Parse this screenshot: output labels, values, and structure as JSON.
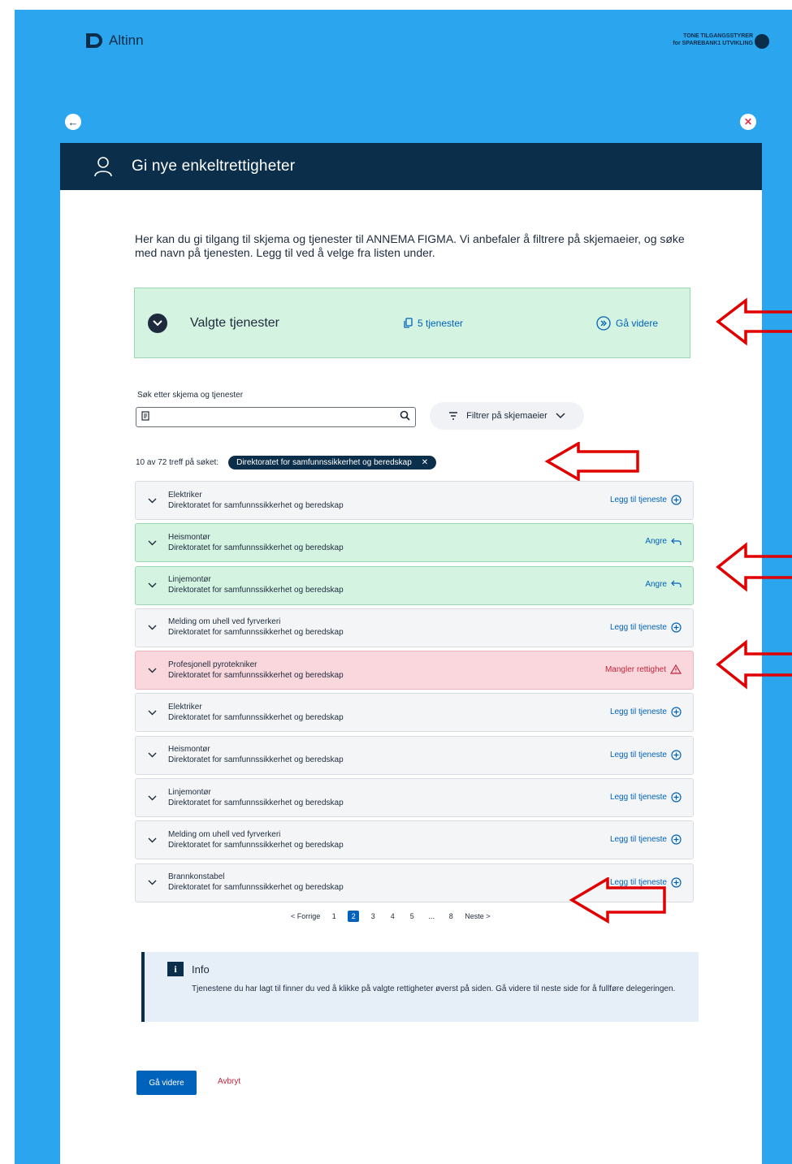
{
  "brand": {
    "name": "Altinn"
  },
  "user": {
    "name": "TONE TILGANGSSTYRER",
    "org": "for SPAREBANK1 UTVIKLING"
  },
  "header": {
    "title": "Gi nye enkeltrettigheter"
  },
  "intro": "Her kan du gi tilgang til skjema og tjenester til ANNEMA FIGMA. Vi anbefaler å filtrere på skjemaeier, og søke med navn på tjenesten. Legg til ved å velge fra listen under.",
  "selected": {
    "title": "Valgte tjenester",
    "count": "5 tjenester",
    "next": "Gå videre"
  },
  "search": {
    "label": "Søk etter skjema og tjenester",
    "value": "",
    "placeholder": ""
  },
  "filter": {
    "label": "Filtrer på skjemaeier"
  },
  "results": {
    "summary": "10 av 72 treff på søket:",
    "chip": "Direktoratet for samfunnssikkerhet og beredskap"
  },
  "services": [
    {
      "title": "Elektriker",
      "owner": "Direktoratet for samfunnssikkerhet og beredskap",
      "action": "Legg til tjeneste",
      "state": "default"
    },
    {
      "title": "Heismontør",
      "owner": "Direktoratet for samfunnssikkerhet og beredskap",
      "action": "Angre",
      "state": "added"
    },
    {
      "title": "Linjemontør",
      "owner": "Direktoratet for samfunnssikkerhet og beredskap",
      "action": "Angre",
      "state": "added"
    },
    {
      "title": "Melding om uhell ved fyrverkeri",
      "owner": "Direktoratet for samfunnssikkerhet og beredskap",
      "action": "Legg til tjeneste",
      "state": "default"
    },
    {
      "title": "Profesjonell pyrotekniker",
      "owner": "Direktoratet for samfunnssikkerhet og beredskap",
      "action": "Mangler rettighet",
      "state": "error"
    },
    {
      "title": "Elektriker",
      "owner": "Direktoratet for samfunnssikkerhet og beredskap",
      "action": "Legg til tjeneste",
      "state": "default"
    },
    {
      "title": "Heismontør",
      "owner": "Direktoratet for samfunnssikkerhet og beredskap",
      "action": "Legg til tjeneste",
      "state": "default"
    },
    {
      "title": "Linjemontør",
      "owner": "Direktoratet for samfunnssikkerhet og beredskap",
      "action": "Legg til tjeneste",
      "state": "default"
    },
    {
      "title": "Melding om uhell ved fyrverkeri",
      "owner": "Direktoratet for samfunnssikkerhet og beredskap",
      "action": "Legg til tjeneste",
      "state": "default"
    },
    {
      "title": "Brannkonstabel",
      "owner": "Direktoratet for samfunnssikkerhet og beredskap",
      "action": "Legg til tjeneste",
      "state": "default"
    }
  ],
  "pagination": {
    "prev": "< Forrige",
    "pages": [
      "1",
      "2",
      "3",
      "4",
      "5",
      "...",
      "8"
    ],
    "active": "2",
    "next": "Neste >"
  },
  "info": {
    "title": "Info",
    "body": "Tjenestene du har lagt til finner du ved å klikke på valgte rettigheter øverst på siden. Gå videre til neste side for å fullføre delegeringen."
  },
  "footer": {
    "next": "Gå videre",
    "cancel": "Avbryt"
  },
  "colors": {
    "background": "#2aa5ee",
    "header": "#0b2e4a",
    "accent": "#0062ba",
    "added": "#d4f3e1",
    "error": "#f9d7dc",
    "annotation": "#e00000"
  }
}
